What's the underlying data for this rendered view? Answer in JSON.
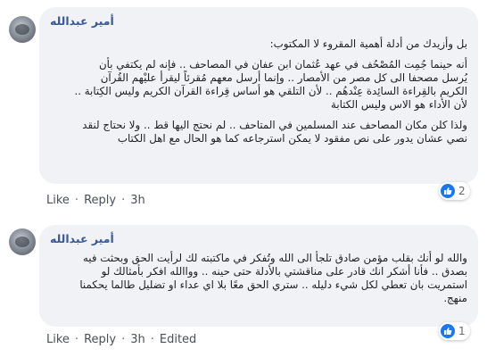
{
  "comments": [
    {
      "author": "أمير عبدالله",
      "paragraphs": [
        "بل وأزيدك من أدلة أهمية المقروء لا المكتوب:",
        "أنه حينما جُمِت المُصْحُف في عهد عُثمان ابن عفان في المصاحف .. فإنه لم يكتفي بأن\nيُرسل مصحفا الى كل مصر من الأمصار .. وإنما أرسل معهم مُقرئاً ليقرأ عليْهم القُرآن\nالكريم بالقِراءة السائِدة عِنْدهُم .. لأن التلقي هو أساس قِراءة القرآن الكريم وليس الكِتابة ..\nلأن الأداء هو الاس وليس الكتابة",
        "ولذا كلن مكان المصاحف عند المسلمين في المتاحف .. لم نحتج اليها قط .. ولا نحتاج لنقد\nنصي عشان يدور على نص مفقود لا يمكن استرجاعه كما هو الحال مع اهل الكتاب"
      ],
      "actions": {
        "like": "Like",
        "reply": "Reply",
        "time": "3h",
        "edited": ""
      },
      "reaction_count": "2"
    },
    {
      "author": "أمير عبدالله",
      "paragraphs": [
        "والله لو أنك بقلب مؤمن صادق تلجأ الى الله وتُفكر في ماكتبته لك لرأيت الحق وبحثت فيه\nبصدق .. فأنا أشكر انك قادر على مناقشتي بالأدلة حتى حينه .. وواالله افكر بأمثالك لو\nاستمريت بان تعطي لكل شيء دليله .. ستري الحق معًا بلا اي عداء او تضليل طالما يحكمنا\nمنهج."
      ],
      "actions": {
        "like": "Like",
        "reply": "Reply",
        "time": "3h",
        "edited": "Edited"
      },
      "reaction_count": "1"
    }
  ],
  "colors": {
    "author": "#385898",
    "bubble": "#f0f2f5",
    "like_blue": "#1877f2",
    "muted": "#65676b"
  },
  "icons": {
    "avatar": "user-avatar",
    "reaction": "thumbs-up-icon"
  }
}
